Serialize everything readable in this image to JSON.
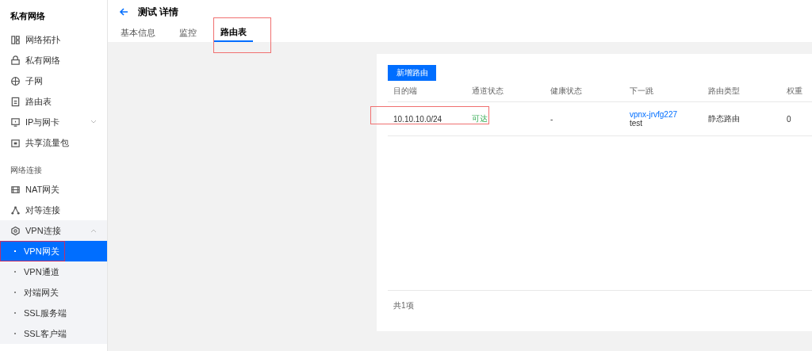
{
  "sidebar": {
    "title": "私有网络",
    "groups": [
      {
        "items": [
          {
            "label": "网络拓扑"
          },
          {
            "label": "私有网络"
          },
          {
            "label": "子网"
          },
          {
            "label": "路由表"
          },
          {
            "label": "IP与网卡",
            "expanded": false
          },
          {
            "label": "共享流量包"
          }
        ]
      },
      {
        "heading": "网络连接",
        "items": [
          {
            "label": "NAT网关"
          },
          {
            "label": "对等连接"
          },
          {
            "label": "VPN连接",
            "expanded": true,
            "children": [
              {
                "label": "VPN网关",
                "selected": true,
                "annotated": true
              },
              {
                "label": "VPN通道",
                "selected": false,
                "annotated": false
              },
              {
                "label": "对端网关",
                "selected": false,
                "annotated": false
              },
              {
                "label": "SSL服务端",
                "selected": false,
                "annotated": false
              },
              {
                "label": "SSL客户端",
                "selected": false,
                "annotated": false
              }
            ]
          }
        ]
      }
    ]
  },
  "header": {
    "title": "测试 详情",
    "tabs": [
      {
        "label": "基本信息",
        "selected": false,
        "annotated": false
      },
      {
        "label": "监控",
        "selected": false,
        "annotated": false
      },
      {
        "label": "路由表",
        "selected": true,
        "annotated": true
      }
    ]
  },
  "route_table": {
    "add_button": "新增路由",
    "columns": [
      "目的端",
      "通道状态",
      "健康状态",
      "下一跳",
      "路由类型",
      "权重"
    ],
    "rows": [
      {
        "destination": "10.10.10.0/24",
        "status": "可达",
        "health": "-",
        "next_hop": "vpnx-jrvfg227",
        "next_hop_name": "test",
        "route_type": "静态路由",
        "weight": "0",
        "annotated": true
      }
    ],
    "footer": "共1项"
  }
}
